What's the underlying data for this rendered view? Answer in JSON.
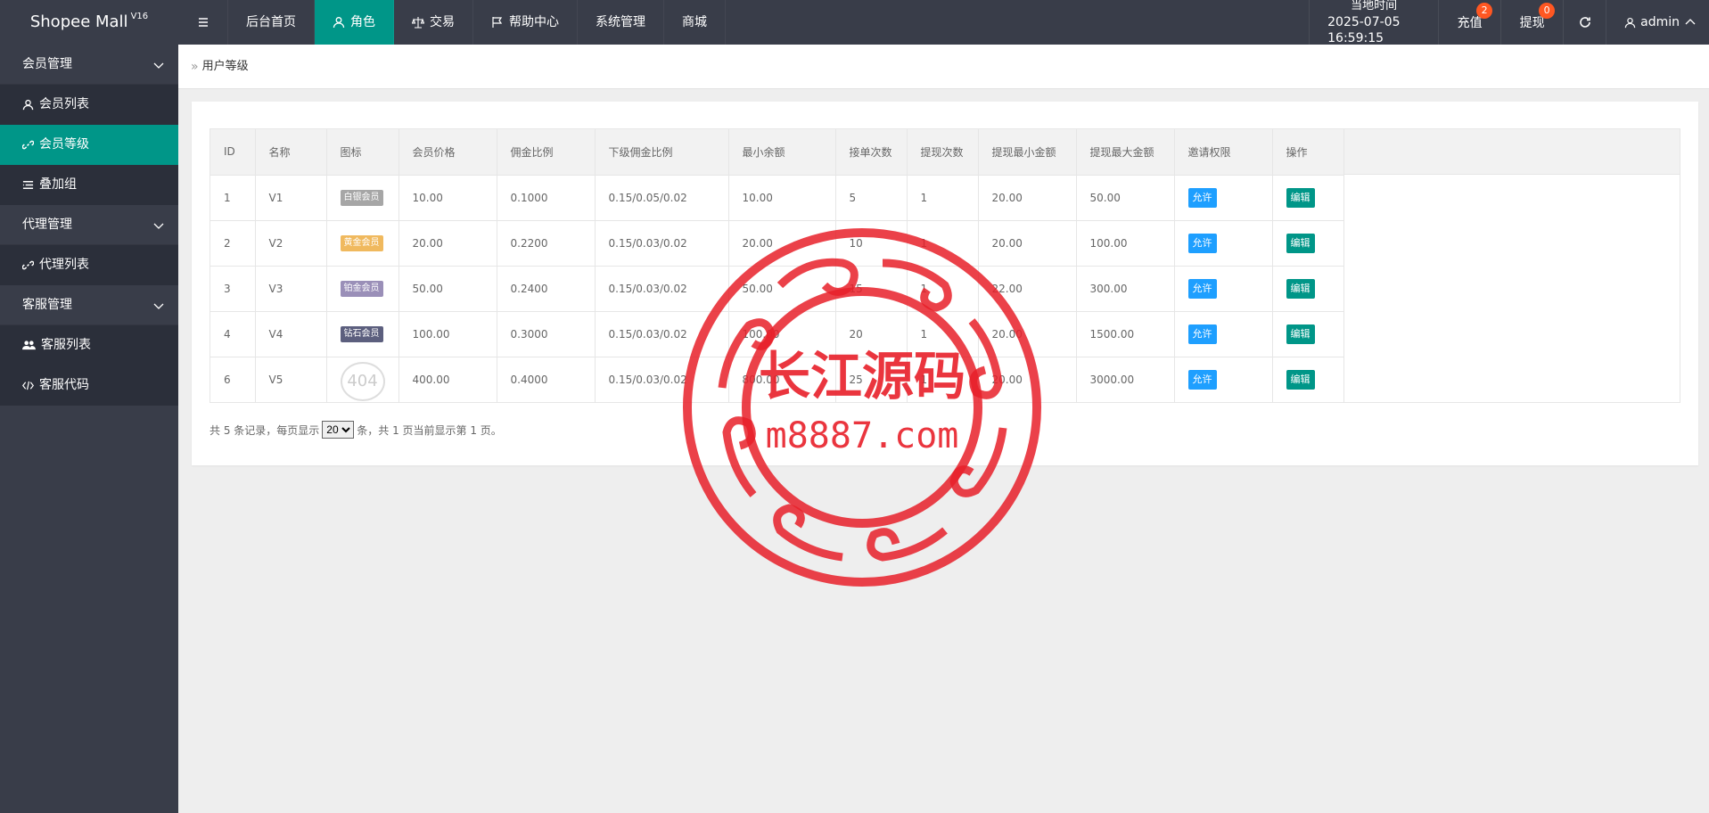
{
  "app": {
    "title": "Shopee Mall",
    "version": "V16"
  },
  "topnav": {
    "items": [
      "后台首页",
      "角色",
      "交易",
      "帮助中心",
      "系统管理",
      "商城"
    ]
  },
  "header_right": {
    "time_label": "当地时间",
    "time_value": "2025-07-05 16:59:15",
    "recharge_label": "充值",
    "recharge_badge": "2",
    "withdraw_label": "提现",
    "withdraw_badge": "0",
    "user": "admin"
  },
  "sidebar": {
    "groups": [
      {
        "label": "会员管理",
        "items": [
          "会员列表",
          "会员等级",
          "叠加组"
        ]
      },
      {
        "label": "代理管理",
        "items": [
          "代理列表"
        ]
      },
      {
        "label": "客服管理",
        "items": [
          "客服列表",
          "客服代码"
        ]
      }
    ],
    "active_item": "会员等级"
  },
  "breadcrumb": {
    "current": "用户等级"
  },
  "table": {
    "headers": [
      "ID",
      "名称",
      "图标",
      "会员价格",
      "佣金比例",
      "下级佣金比例",
      "最小余额",
      "接单次数",
      "提现次数",
      "提现最小金额",
      "提现最大金额",
      "邀请权限",
      "操作"
    ],
    "rows": [
      {
        "id": "1",
        "name": "V1",
        "icon_text": "白银会员",
        "icon_color": "#a6a6a6",
        "price": "10.00",
        "commission": "0.1000",
        "sub_commission": "0.15/0.05/0.02",
        "min_balance": "10.00",
        "orders": "5",
        "withdraw_times": "1",
        "withdraw_min": "20.00",
        "withdraw_max": "50.00",
        "invite": "允许",
        "action": "编辑"
      },
      {
        "id": "2",
        "name": "V2",
        "icon_text": "黄金会员",
        "icon_color": "#f0b95e",
        "price": "20.00",
        "commission": "0.2200",
        "sub_commission": "0.15/0.03/0.02",
        "min_balance": "20.00",
        "orders": "10",
        "withdraw_times": "1",
        "withdraw_min": "20.00",
        "withdraw_max": "100.00",
        "invite": "允许",
        "action": "编辑"
      },
      {
        "id": "3",
        "name": "V3",
        "icon_text": "铂金会员",
        "icon_color": "#9a8fb8",
        "price": "50.00",
        "commission": "0.2400",
        "sub_commission": "0.15/0.03/0.02",
        "min_balance": "50.00",
        "orders": "15",
        "withdraw_times": "1",
        "withdraw_min": "22.00",
        "withdraw_max": "300.00",
        "invite": "允许",
        "action": "编辑"
      },
      {
        "id": "4",
        "name": "V4",
        "icon_text": "钻石会员",
        "icon_color": "#5c5f7e",
        "price": "100.00",
        "commission": "0.3000",
        "sub_commission": "0.15/0.03/0.02",
        "min_balance": "100.00",
        "orders": "20",
        "withdraw_times": "1",
        "withdraw_min": "20.00",
        "withdraw_max": "1500.00",
        "invite": "允许",
        "action": "编辑"
      },
      {
        "id": "6",
        "name": "V5",
        "icon_text": "404",
        "icon_color": "",
        "price": "400.00",
        "commission": "0.4000",
        "sub_commission": "0.15/0.03/0.02",
        "min_balance": "800.00",
        "orders": "25",
        "withdraw_times": "1",
        "withdraw_min": "20.00",
        "withdraw_max": "3000.00",
        "invite": "允许",
        "action": "编辑"
      }
    ]
  },
  "pager": {
    "prefix": "共 5 条记录，每页显示",
    "page_size": "20",
    "suffix": "条，共 1 页当前显示第 1 页。"
  },
  "watermark": {
    "title": "长江源码",
    "url": "m8887.com",
    "color": "#e8202a"
  }
}
